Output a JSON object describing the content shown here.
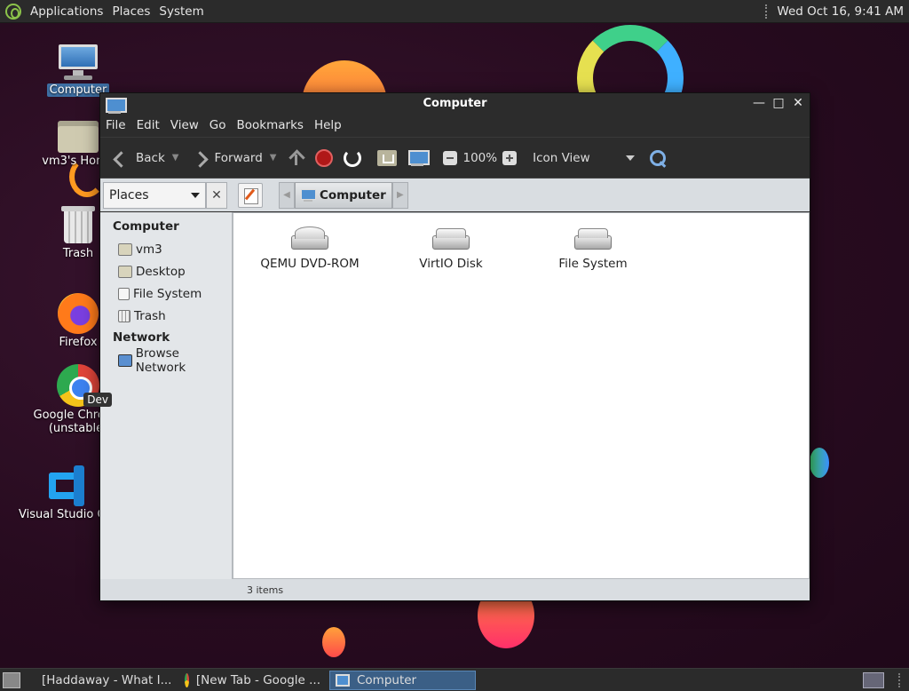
{
  "top_panel": {
    "menus": [
      "Applications",
      "Places",
      "System"
    ],
    "clock": "Wed Oct 16,  9:41 AM"
  },
  "desktop_icons": [
    {
      "label": "Computer",
      "icon": "computer-icon"
    },
    {
      "label": "vm3's Home",
      "icon": "home-folder-icon"
    },
    {
      "label": "Trash",
      "icon": "trash-icon"
    },
    {
      "label": "Firefox",
      "icon": "firefox-icon"
    },
    {
      "label": "Google Chrome (unstable)",
      "line1": "Google Chrome",
      "line2": "(unstable)",
      "badge": "Dev",
      "icon": "chrome-icon"
    },
    {
      "label": "Visual Studio Code",
      "icon": "vscode-icon"
    }
  ],
  "window": {
    "title": "Computer",
    "menu": [
      "File",
      "Edit",
      "View",
      "Go",
      "Bookmarks",
      "Help"
    ],
    "toolbar": {
      "back": "Back",
      "forward": "Forward",
      "zoom": "100%",
      "view_mode": "Icon View"
    },
    "location": {
      "side_pane": "Places",
      "crumb": "Computer"
    },
    "sidebar": {
      "sections": [
        {
          "heading": "Computer",
          "items": [
            "vm3",
            "Desktop",
            "File System",
            "Trash"
          ]
        },
        {
          "heading": "Network",
          "items": [
            "Browse Network"
          ]
        }
      ]
    },
    "files": [
      {
        "name": "QEMU DVD-ROM",
        "icon": "optical-drive-icon"
      },
      {
        "name": "VirtIO Disk",
        "icon": "hard-disk-icon"
      },
      {
        "name": "File System",
        "icon": "hard-disk-icon"
      }
    ],
    "status": "3 items"
  },
  "taskbar": {
    "tasks": [
      {
        "label": "[Haddaway - What I...",
        "icon": "firefox-icon",
        "active": false
      },
      {
        "label": "[New Tab - Google ...",
        "icon": "chrome-icon",
        "active": false
      },
      {
        "label": "Computer",
        "icon": "computer-icon",
        "active": true
      }
    ]
  }
}
